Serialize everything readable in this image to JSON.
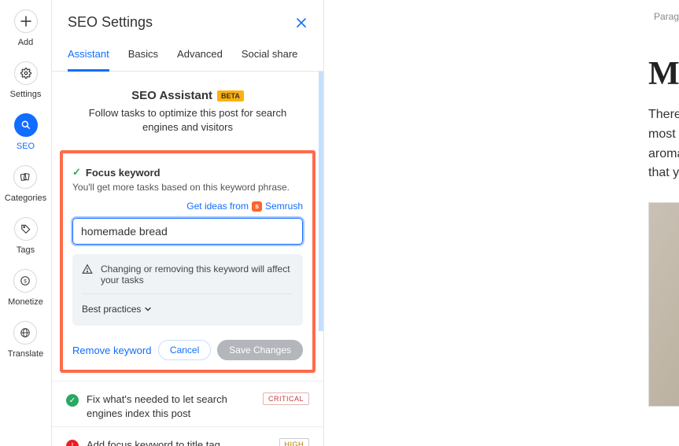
{
  "rail": {
    "add": "Add",
    "settings": "Settings",
    "seo": "SEO",
    "categories": "Categories",
    "tags": "Tags",
    "monetize": "Monetize",
    "translate": "Translate"
  },
  "panel": {
    "title": "SEO Settings",
    "tabs": {
      "assistant": "Assistant",
      "basics": "Basics",
      "advanced": "Advanced",
      "social": "Social share"
    },
    "assistant_title": "SEO Assistant",
    "beta": "BETA",
    "assistant_sub": "Follow tasks to optimize this post for search engines and visitors"
  },
  "focus": {
    "title": "Focus keyword",
    "sub": "You'll get more tasks based on this keyword phrase.",
    "ideas_prefix": "Get ideas from",
    "semrush": "Semrush",
    "value": "homemade bread",
    "warn": "Changing or removing this keyword will affect your tasks",
    "best_practices": "Best practices",
    "remove": "Remove keyword",
    "cancel": "Cancel",
    "save": "Save Changes"
  },
  "tasks": {
    "fix_index": "Fix what's needed to let search engines index this post",
    "critical": "CRITICAL",
    "add_title": "Add focus keyword to title tag",
    "high": "HIGH"
  },
  "content": {
    "toolbar_hint": "Parag",
    "title_start": "Mi",
    "body": "There\nmost\naroma\nthat y"
  }
}
